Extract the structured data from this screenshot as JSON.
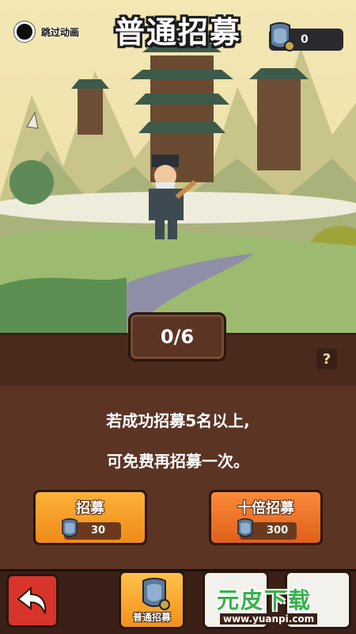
{
  "header": {
    "skip_label": "跳过动画",
    "title": "普通招募",
    "currency_value": "0"
  },
  "panel": {
    "counter": "0/6",
    "help": "?",
    "info_line1": "若成功招募5名以上,",
    "info_line2": "可免费再招募一次。"
  },
  "buttons": {
    "single_label": "招募",
    "single_cost": "30",
    "ten_label": "十倍招募",
    "ten_cost": "300"
  },
  "bottom_nav": {
    "normal_label": "普通招募"
  },
  "watermark": {
    "logo": "元皮下载",
    "url": "www.yuanpi.com"
  },
  "colors": {
    "panel": "#5b3424",
    "button_orange": "#f5a028",
    "button_deep": "#e8702a",
    "back_red": "#d9342a"
  }
}
